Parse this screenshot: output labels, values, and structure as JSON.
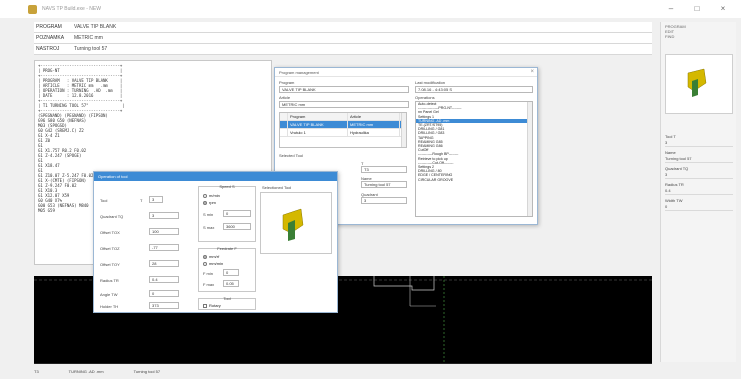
{
  "window": {
    "title": "NAVS TP Build.exe - NEW",
    "controls": [
      "–",
      "□",
      "×"
    ]
  },
  "header": {
    "rows": [
      {
        "label": "PROGRAM",
        "value": "VALVE TIP BLANK"
      },
      {
        "label": "POZNAMKA",
        "value": "METRIC mm"
      },
      {
        "label": "NASTROJ",
        "value": "Turning tool 57"
      }
    ]
  },
  "program_text": [
    "+---------------------------------+",
    "| PROG-NT                         |",
    "+---------------------------------+",
    "| PROGRAM   : VALVE TIP BLANK     |",
    "| ARTICLE   : METRIC mm   .mm     |",
    "| OPERATION : TURNING  .AD  .mm   |",
    "| DATE      : 12.8.2016           |",
    "+---------------------------------+",
    "| T1 TURNING TOOL 57\"              |",
    "+---------------------------------+",
    "(SPEGNAND) (PEGNAND) (FIPSON)",
    "G96 S80 G50 (NEFNAS)",
    "M03 (SPOGSD)",
    "",
    "G0 G42 (SREMJ.C) Z2",
    "G1 X-4 Z1",
    "G1 Z0",
    "G1",
    "G1 X1.757 R0.2 F0.02",
    "G1 Z-4.247 (SPOGE)",
    "G1",
    "G1 X18.47",
    "G1",
    "G1 Z10.07 Z-5.247 F0.02",
    "G1 X-(CMTE) (FIPSON)",
    "G1 Z-9.247 F0.02",
    "G1 X10.3",
    "G1 X12.07 X59",
    "G0 G40 X7%",
    "",
    "G00 G53 (NEFNAS) M840",
    "M05 G59"
  ],
  "program_dialog": {
    "title": "Program management",
    "program_label": "Program",
    "program_value": "VALVE TIP BLANK",
    "article_label": "Article",
    "article_value": "METRIC mm",
    "table_headers": [
      "",
      "Program",
      "Article"
    ],
    "table_rows": [
      {
        "marker": "",
        "program": "VALVE TIP BLANK",
        "article": "METRIC mm"
      },
      {
        "marker": "",
        "program": "Vrutulo 1",
        "article": "Hydraulika"
      }
    ],
    "selected_tool_label": "Selected Tool",
    "t_label": "T",
    "t_value": "T3",
    "name_label": "Name",
    "name_value": "Turning tool 57",
    "quadrant_label": "Quadrant",
    "quadrant_value": "3",
    "lastmod_label": "Last modification",
    "lastmod_value": "7.08.16  -  4:43:05 S",
    "operations_label": "Operations",
    "operations": [
      {
        "text": "Auto-detect",
        "selected": false
      },
      {
        "text": "-----------------PRG-NT--------",
        "selected": false
      },
      {
        "text": "nn Panel Gel",
        "selected": false
      },
      {
        "text": "Settings 1",
        "selected": false
      },
      {
        "text": "TURNING .AD .mm",
        "selected": true
      },
      {
        "text": "TE.(ZRT/ST95)",
        "selected": false
      },
      {
        "text": "DRILLING / G81",
        "selected": false
      },
      {
        "text": "DRILLING / G83",
        "selected": false
      },
      {
        "text": "TAPPING",
        "selected": false
      },
      {
        "text": "REAMING G85",
        "selected": false
      },
      {
        "text": "REAMING G86",
        "selected": false
      },
      {
        "text": "CutOff",
        "selected": false
      },
      {
        "text": "------------Rough BP--------",
        "selected": false
      },
      {
        "text": "Retrieve to pick up",
        "selected": false
      },
      {
        "text": "------------Cut-Off--------",
        "selected": false
      },
      {
        "text": "Settings 2",
        "selected": false
      },
      {
        "text": "DRILLING / 80",
        "selected": false
      },
      {
        "text": "EDGE / CENTERING",
        "selected": false
      },
      {
        "text": "CIRCULAR GROOVE",
        "selected": false
      }
    ]
  },
  "op_dialog": {
    "title": "Operation of tool",
    "tool_label": "Tool",
    "tool_t": "T",
    "tool_value": "3",
    "fields": [
      {
        "label": "Quadrant  TQ",
        "value": "3"
      },
      {
        "label": "Offset  TOX",
        "value": "100"
      },
      {
        "label": "Offset  TOZ",
        "value": "-77"
      },
      {
        "label": "Offset  TOY",
        "value": "28"
      },
      {
        "label": "Radius  TR",
        "value": "0.4"
      },
      {
        "label": "Angle  TW",
        "value": "0"
      },
      {
        "label": "Holder  TH",
        "value": "373"
      }
    ],
    "speed_group": "Speed  S",
    "speed_opt1": "m/min",
    "speed_opt2": "rpm",
    "smin_label": "S min",
    "smin_value": "0",
    "smax_label": "S max",
    "smax_value": "3600",
    "feed_group": "Feedrate F",
    "feed_opt1": "mm/rf",
    "feed_opt2": "mm/min",
    "fmin_label": "F min",
    "fmin_value": "0",
    "fmax_label": "F max",
    "fmax_value": "0.05",
    "tool_group": "Tool",
    "rotary_label": "Rotary",
    "selected_tool_label": "Selectioned Tool"
  },
  "right_panel": {
    "top_lines": [
      "PROGRAM",
      "EDIT",
      "FIND"
    ],
    "fields": [
      {
        "label": "Tool  T",
        "value": "3"
      },
      {
        "label": "Name",
        "value": "Turning tool 57"
      },
      {
        "label": "Quadrant  TQ",
        "value": "3"
      },
      {
        "label": "Radius  TR",
        "value": "0.4"
      },
      {
        "label": "Width  TW",
        "value": "0"
      }
    ]
  },
  "statusbar": {
    "left": "T3",
    "middle": "TURNING .AD .mm",
    "right": "Turning tool 57"
  },
  "colors": {
    "accent": "#3d8bd5",
    "graphic_bg": "#000000",
    "tool_yellow": "#d4b800",
    "tool_green": "#3a7f35"
  }
}
